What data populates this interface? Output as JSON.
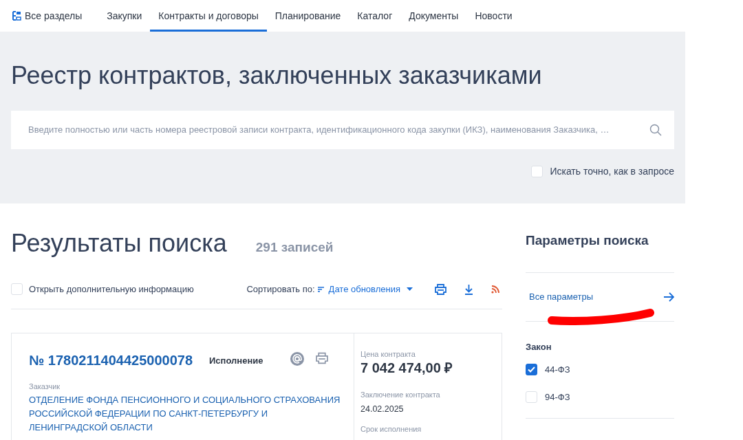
{
  "nav": {
    "all_sections": "Все разделы",
    "tabs": [
      {
        "label": "Закупки",
        "selected": false
      },
      {
        "label": "Контракты и договоры",
        "selected": true
      },
      {
        "label": "Планирование",
        "selected": false
      },
      {
        "label": "Каталог",
        "selected": false
      },
      {
        "label": "Документы",
        "selected": false
      },
      {
        "label": "Новости",
        "selected": false
      }
    ]
  },
  "header": {
    "title": "Реестр контрактов, заключенных заказчиками",
    "search": {
      "placeholder": "Введите полностью или часть номера реестровой записи контракта, идентификационного кода закупки (ИКЗ), наименования Заказчика, …"
    },
    "exact": {
      "label": "Искать точно, как в запросе",
      "checked": false
    }
  },
  "results": {
    "title": "Результаты поиска",
    "count": "291 записей",
    "more_info": {
      "label": "Открыть дополнительную информацию",
      "checked": false
    },
    "sort_label": "Сортировать по:",
    "sort_value": "Дате обновления",
    "card": {
      "number": "№ 1780211404425000078",
      "status": "Исполнение",
      "customer_label": "Заказчик",
      "customer": "ОТДЕЛЕНИЕ ФОНДА ПЕНСИОННОГО И СОЦИАЛЬНОГО СТРАХОВАНИЯ РОССИЙСКОЙ ФЕДЕРАЦИИ ПО САНКТ-ПЕТЕРБУРГУ И ЛЕНИНГРАДСКОЙ ОБЛАСТИ",
      "price_label": "Цена контракта",
      "price": "7 042 474,00 ₽",
      "concluded_label": "Заключение контракта",
      "concluded": "24.02.2025",
      "term_label": "Срок исполнения"
    }
  },
  "params": {
    "title": "Параметры поиска",
    "all_link": "Все параметры",
    "law_title": "Закон",
    "laws": [
      {
        "label": "44-ФЗ",
        "checked": true
      },
      {
        "label": "94-ФЗ",
        "checked": false
      }
    ]
  }
}
